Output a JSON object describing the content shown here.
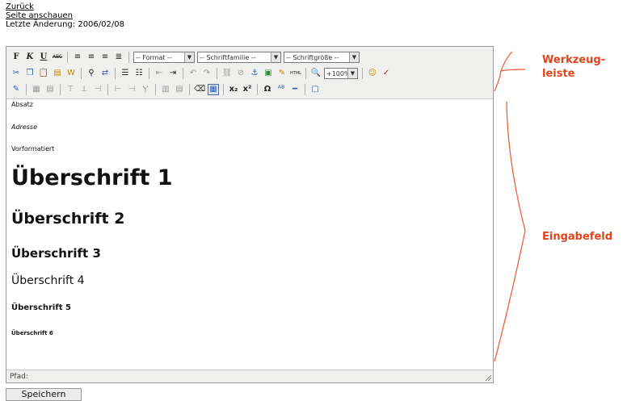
{
  "links": {
    "back": "Zurück",
    "view_page": "Seite anschauen",
    "last_change": "Letzte Änderung: 2006/02/08"
  },
  "toolbar": {
    "row1": {
      "bold_icon": "bold-icon",
      "bold": "F",
      "italic": "K",
      "underline": "U",
      "strike": "ABC",
      "format_select": "-- Format --",
      "font_family_select": "-- Schriftfamilie --",
      "font_size_select": "-- Schriftgröße --"
    },
    "row2": {
      "zoom_select": "+100%",
      "html_label": "HTML"
    },
    "row3": {
      "sub": "x₂",
      "sup": "x²",
      "omega": "Ω"
    }
  },
  "content": {
    "absatz": "Absatz",
    "adresse": "Adresse",
    "vorformatiert": "Vorformatiert",
    "h1": "Überschrift 1",
    "h2": "Überschrift 2",
    "h3": "Überschrift 3",
    "h4": "Überschrift 4",
    "h5": "Überschrift 5",
    "h6": "Überschrift 6"
  },
  "path_label": "Pfad:",
  "save_button": "Speichern",
  "annotations": {
    "toolbar_line1": "Werkzeug-",
    "toolbar_line2": "leiste",
    "input_field": "Eingabefeld"
  },
  "colors": {
    "annotation": "#e0441b",
    "toolbar_bg": "#f0f0ee"
  }
}
